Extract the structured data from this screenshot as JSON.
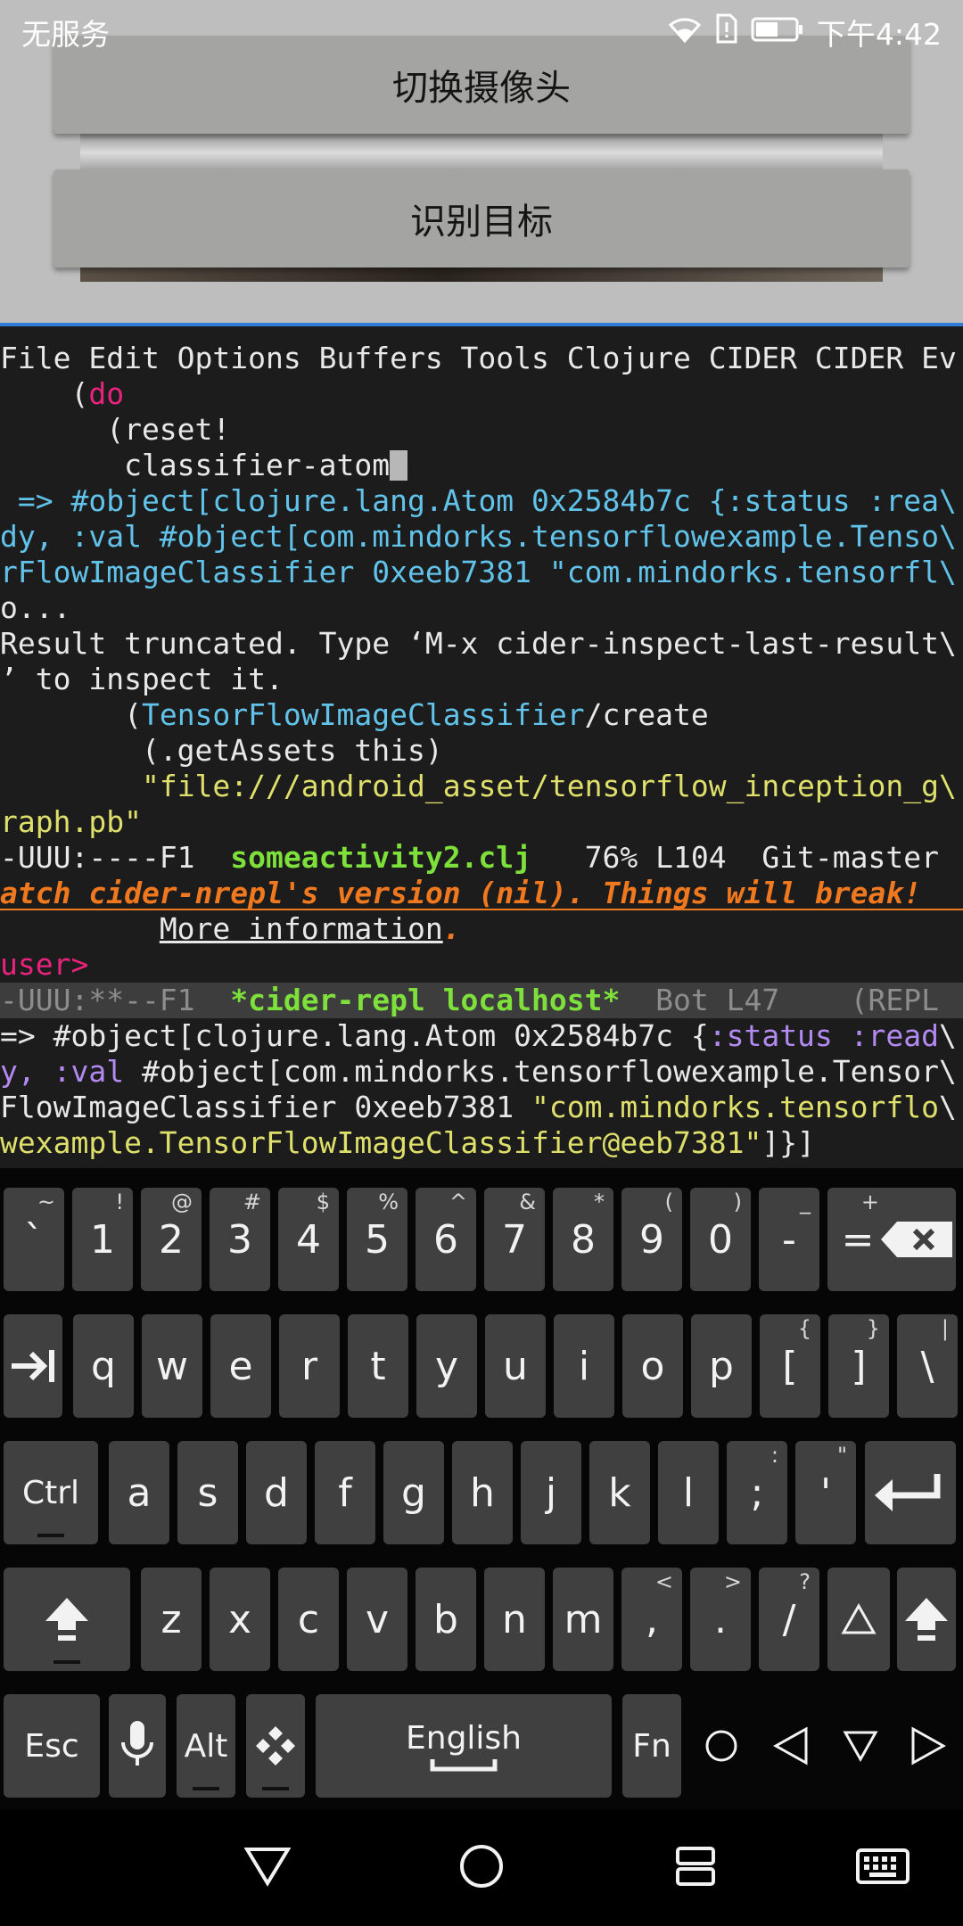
{
  "status_bar": {
    "carrier": "无服务",
    "time": "下午4:42",
    "icons": [
      "wifi-icon",
      "sim-alert-icon",
      "battery-icon"
    ]
  },
  "app": {
    "switch_camera_label": "切换摄像头",
    "recognize_label": "识别目标"
  },
  "emacs": {
    "menu_bar": "File Edit Options Buffers Tools Clojure CIDER CIDER Ev",
    "code": {
      "l1_paren": "    (",
      "l1_kw": "do",
      "l2": "      (reset!",
      "l3": "       classifier-atom",
      "r1a": " => ",
      "r1b": "#object[clojure.lang.Atom 0x2584b7c {:status :rea\\",
      "r2": "dy, :val #object[com.mindorks.tensorflowexample.Tenso\\",
      "r3": "rFlowImageClassifier 0xeeb7381 \"com.mindorks.tensorfl\\",
      "r4": "o...",
      "t1": "Result truncated. Type ‘M-x cider-inspect-last-result\\",
      "t2": "’ to inspect it.",
      "c1a": "       (",
      "c1b": "TensorFlowImageClassifier",
      "c1c": "/create",
      "c2": "        (.getAssets this)",
      "c3a": "        ",
      "c3b": "\"file:///android_asset/tensorflow_inception_g\\",
      "c4": "raph.pb\""
    },
    "modeline1": {
      "prefix": "-UUU:----F1  ",
      "buffer": "someactivity2.clj",
      "suffix": "   76% L104  Git-master "
    },
    "warning": {
      "text": "atch cider-nrepl's version (nil). Things will break!",
      "indent": "         ",
      "link": "More information",
      "period": "."
    },
    "prompt": "user>",
    "modeline2": {
      "prefix": "-UUU:**--F1  ",
      "buffer": "*cider-repl localhost*",
      "suffix": "  Bot L47    (REPL"
    },
    "echo": {
      "e1a": "=> #object[clojure.lang.Atom 0x2584b7c {",
      "e1b": ":status :read",
      "e1c": "\\",
      "e2a": "y, ",
      "e2b": ":val",
      "e2c": " #object[com.mindorks.tensorflowexample.Tensor\\",
      "e3a": "FlowImageClassifier 0xeeb7381 ",
      "e3b": "\"com.mindorks.tensorflo",
      "e3c": "\\",
      "e4a": "wexample.TensorFlowImageClassifier@eeb7381\"",
      "e4b": "]}]"
    }
  },
  "keyboard": {
    "row1": [
      {
        "main": "`",
        "alt": "~"
      },
      {
        "main": "1",
        "alt": "!"
      },
      {
        "main": "2",
        "alt": "@"
      },
      {
        "main": "3",
        "alt": "#"
      },
      {
        "main": "4",
        "alt": "$"
      },
      {
        "main": "5",
        "alt": "%"
      },
      {
        "main": "6",
        "alt": "^"
      },
      {
        "main": "7",
        "alt": "&"
      },
      {
        "main": "8",
        "alt": "*"
      },
      {
        "main": "9",
        "alt": "("
      },
      {
        "main": "0",
        "alt": ")"
      },
      {
        "main": "-",
        "alt": "_"
      },
      {
        "main": "=",
        "alt": "+"
      }
    ],
    "row2": [
      {
        "main": "q",
        "alt": ""
      },
      {
        "main": "w",
        "alt": ""
      },
      {
        "main": "e",
        "alt": ""
      },
      {
        "main": "r",
        "alt": ""
      },
      {
        "main": "t",
        "alt": ""
      },
      {
        "main": "y",
        "alt": ""
      },
      {
        "main": "u",
        "alt": ""
      },
      {
        "main": "i",
        "alt": ""
      },
      {
        "main": "o",
        "alt": ""
      },
      {
        "main": "p",
        "alt": ""
      },
      {
        "main": "[",
        "alt": "{"
      },
      {
        "main": "]",
        "alt": "}"
      },
      {
        "main": "\\",
        "alt": "|"
      }
    ],
    "row3": [
      {
        "main": "a",
        "alt": ""
      },
      {
        "main": "s",
        "alt": ""
      },
      {
        "main": "d",
        "alt": ""
      },
      {
        "main": "f",
        "alt": ""
      },
      {
        "main": "g",
        "alt": ""
      },
      {
        "main": "h",
        "alt": ""
      },
      {
        "main": "j",
        "alt": ""
      },
      {
        "main": "k",
        "alt": ""
      },
      {
        "main": "l",
        "alt": ""
      },
      {
        "main": ";",
        "alt": ":"
      },
      {
        "main": "'",
        "alt": "\""
      }
    ],
    "row4": [
      {
        "main": "z",
        "alt": ""
      },
      {
        "main": "x",
        "alt": ""
      },
      {
        "main": "c",
        "alt": ""
      },
      {
        "main": "v",
        "alt": ""
      },
      {
        "main": "b",
        "alt": ""
      },
      {
        "main": "n",
        "alt": ""
      },
      {
        "main": "m",
        "alt": ""
      },
      {
        "main": ",",
        "alt": "<"
      },
      {
        "main": ".",
        "alt": ">"
      },
      {
        "main": "/",
        "alt": "?"
      }
    ],
    "ctrl_label": "Ctrl",
    "esc_label": "Esc",
    "alt_label": "Alt",
    "space_label": "English",
    "fn_label": "Fn"
  }
}
